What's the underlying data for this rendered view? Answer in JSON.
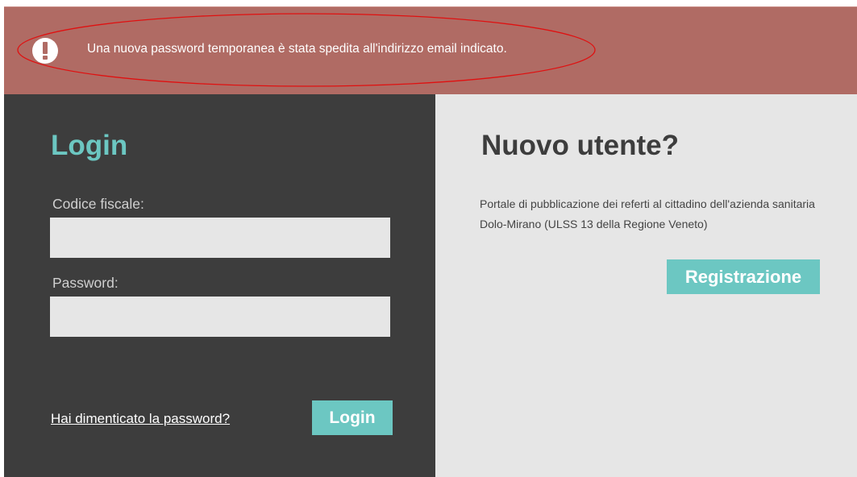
{
  "alert": {
    "icon": "exclamation-icon",
    "message": "Una nuova password temporanea è stata spedita all'indirizzo email indicato.",
    "background_color": "#b06b64",
    "highlight_color": "#e01010"
  },
  "login": {
    "title": "Login",
    "codice_fiscale_label": "Codice fiscale:",
    "codice_fiscale_value": "",
    "password_label": "Password:",
    "password_value": "",
    "forgot_password_link": "Hai dimenticato la password?",
    "submit_label": "Login",
    "panel_color": "#3d3d3d",
    "accent_color": "#6cc7c2"
  },
  "register": {
    "title": "Nuovo utente?",
    "description": "Portale di pubblicazione dei referti al cittadino dell'azienda sanitaria Dolo-Mirano (ULSS 13 della Regione Veneto)",
    "button_label": "Registrazione",
    "panel_color": "#e6e6e6"
  }
}
